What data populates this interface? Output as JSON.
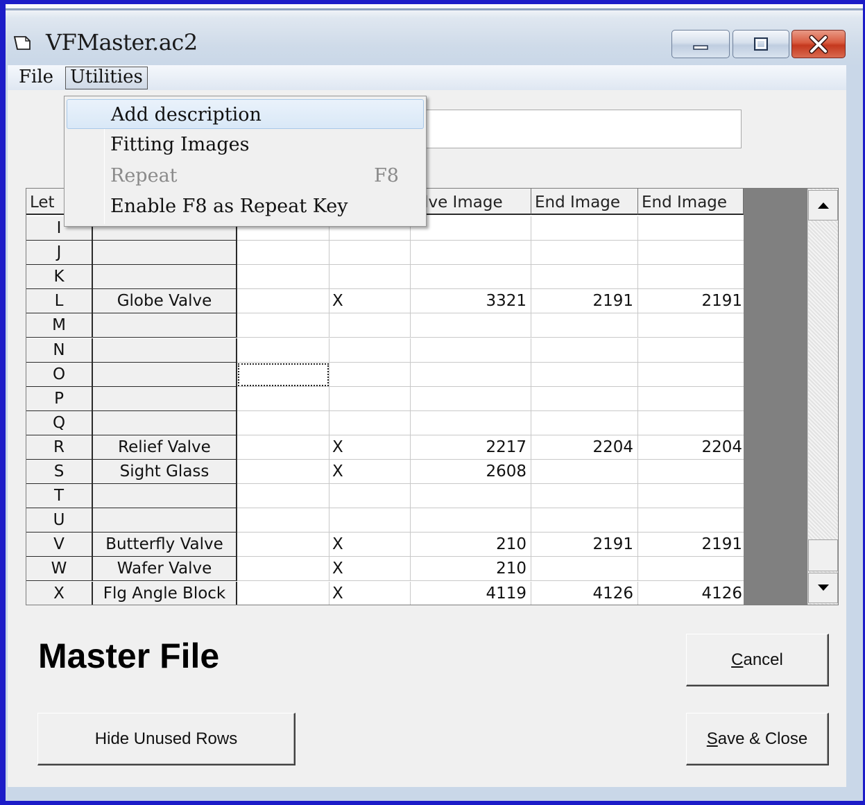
{
  "window": {
    "title": "VFMaster.ac2",
    "icon": "document-icon"
  },
  "menu": {
    "file": "File",
    "utilities": "Utilities"
  },
  "dropdown": {
    "items": [
      {
        "label": "Add description",
        "accel": "",
        "state": "highlighted"
      },
      {
        "label": "Fitting Images",
        "accel": "",
        "state": "enabled"
      },
      {
        "label": "Repeat",
        "accel": "F8",
        "state": "disabled"
      },
      {
        "label": "Enable F8 as Repeat Key",
        "accel": "",
        "state": "enabled"
      }
    ]
  },
  "grid": {
    "headers": [
      "Let",
      "",
      "",
      "",
      "alve Image",
      "End Image",
      "End Image"
    ],
    "rows": [
      {
        "letter": "I",
        "desc": "",
        "c3": "",
        "c4": "",
        "c5": "",
        "c6": "",
        "c7": ""
      },
      {
        "letter": "J",
        "desc": "",
        "c3": "",
        "c4": "",
        "c5": "",
        "c6": "",
        "c7": ""
      },
      {
        "letter": "K",
        "desc": "",
        "c3": "",
        "c4": "",
        "c5": "",
        "c6": "",
        "c7": ""
      },
      {
        "letter": "L",
        "desc": "Globe Valve",
        "c3": "",
        "c4": "X",
        "c5": "3321",
        "c6": "2191",
        "c7": "2191"
      },
      {
        "letter": "M",
        "desc": "",
        "c3": "",
        "c4": "",
        "c5": "",
        "c6": "",
        "c7": ""
      },
      {
        "letter": "N",
        "desc": "",
        "c3": "",
        "c4": "",
        "c5": "",
        "c6": "",
        "c7": ""
      },
      {
        "letter": "O",
        "desc": "",
        "c3": "",
        "c4": "",
        "c5": "",
        "c6": "",
        "c7": ""
      },
      {
        "letter": "P",
        "desc": "",
        "c3": "",
        "c4": "",
        "c5": "",
        "c6": "",
        "c7": ""
      },
      {
        "letter": "Q",
        "desc": "",
        "c3": "",
        "c4": "",
        "c5": "",
        "c6": "",
        "c7": ""
      },
      {
        "letter": "R",
        "desc": "Relief Valve",
        "c3": "",
        "c4": "X",
        "c5": "2217",
        "c6": "2204",
        "c7": "2204"
      },
      {
        "letter": "S",
        "desc": "Sight Glass",
        "c3": "",
        "c4": "X",
        "c5": "2608",
        "c6": "",
        "c7": ""
      },
      {
        "letter": "T",
        "desc": "",
        "c3": "",
        "c4": "",
        "c5": "",
        "c6": "",
        "c7": ""
      },
      {
        "letter": "U",
        "desc": "",
        "c3": "",
        "c4": "",
        "c5": "",
        "c6": "",
        "c7": ""
      },
      {
        "letter": "V",
        "desc": "Butterfly Valve",
        "c3": "",
        "c4": "X",
        "c5": "210",
        "c6": "2191",
        "c7": "2191"
      },
      {
        "letter": "W",
        "desc": "Wafer Valve",
        "c3": "",
        "c4": "X",
        "c5": "210",
        "c6": "",
        "c7": ""
      },
      {
        "letter": "X",
        "desc": "Flg Angle Block",
        "c3": "",
        "c4": "X",
        "c5": "4119",
        "c6": "4126",
        "c7": "4126"
      }
    ]
  },
  "labels": {
    "master_file": "Master File"
  },
  "buttons": {
    "hide_unused": "Hide Unused Rows",
    "cancel_mnemonic": "C",
    "cancel_rest": "ancel",
    "save_mnemonic": "S",
    "save_rest": "ave & Close"
  },
  "colors": {
    "frame_border": "#1c1cc8",
    "close_button": "#d85a3f",
    "grid_dark": "#808080",
    "menu_highlight": "#d9e8f7"
  }
}
